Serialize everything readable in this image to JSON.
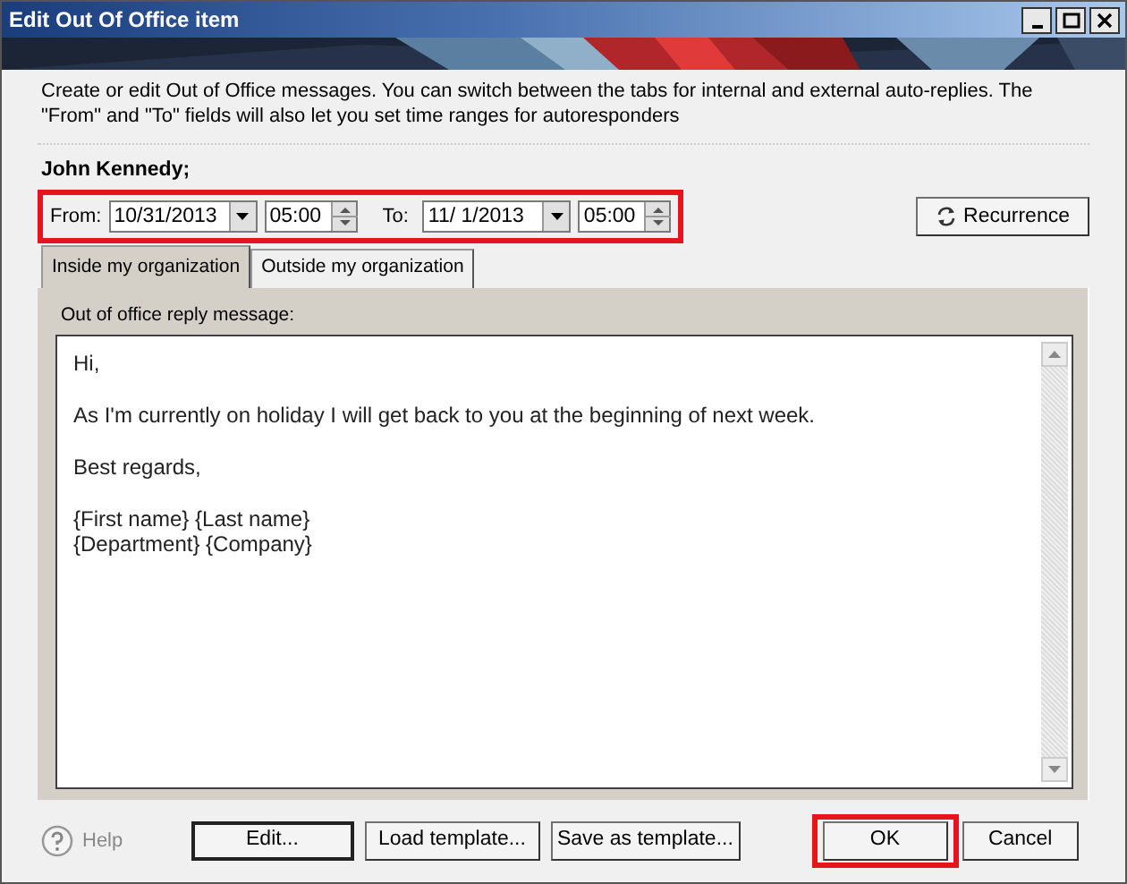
{
  "window": {
    "title": "Edit Out Of Office item"
  },
  "banner": {
    "kind": "picture"
  },
  "description": "Create or edit Out of Office messages. You can switch between the tabs for internal and external auto-replies. The \"From\" and \"To\" fields will also let you set time ranges for autoresponders",
  "user_name": "John Kennedy;",
  "schedule": {
    "highlighted": true,
    "from_label": "From:",
    "from_date": "10/31/2013",
    "from_time": "05:00",
    "to_label": "To:",
    "to_date": "11/ 1/2013",
    "to_time": "05:00"
  },
  "recurrence_button": "Recurrence",
  "tabs": [
    {
      "label": "Inside my organization",
      "selected": true
    },
    {
      "label": "Outside my organization",
      "selected": false
    }
  ],
  "message_label": "Out of office reply message:",
  "message_paragraphs": [
    [
      "Hi,"
    ],
    [
      "As I'm currently on holiday I will get back to you at the beginning of next week."
    ],
    [
      "Best regards,"
    ],
    [
      "{First name} {Last name}",
      "{Department} {Company}"
    ]
  ],
  "help": "Help",
  "buttons": [
    {
      "label": "Edit...",
      "highlighted": false,
      "default": true
    },
    {
      "label": "Load template...",
      "highlighted": false,
      "default": false
    },
    {
      "label": "Save as template...",
      "highlighted": false,
      "default": false
    },
    {
      "label": "OK",
      "highlighted": true,
      "default": false
    },
    {
      "label": "Cancel",
      "highlighted": false,
      "default": false
    }
  ]
}
